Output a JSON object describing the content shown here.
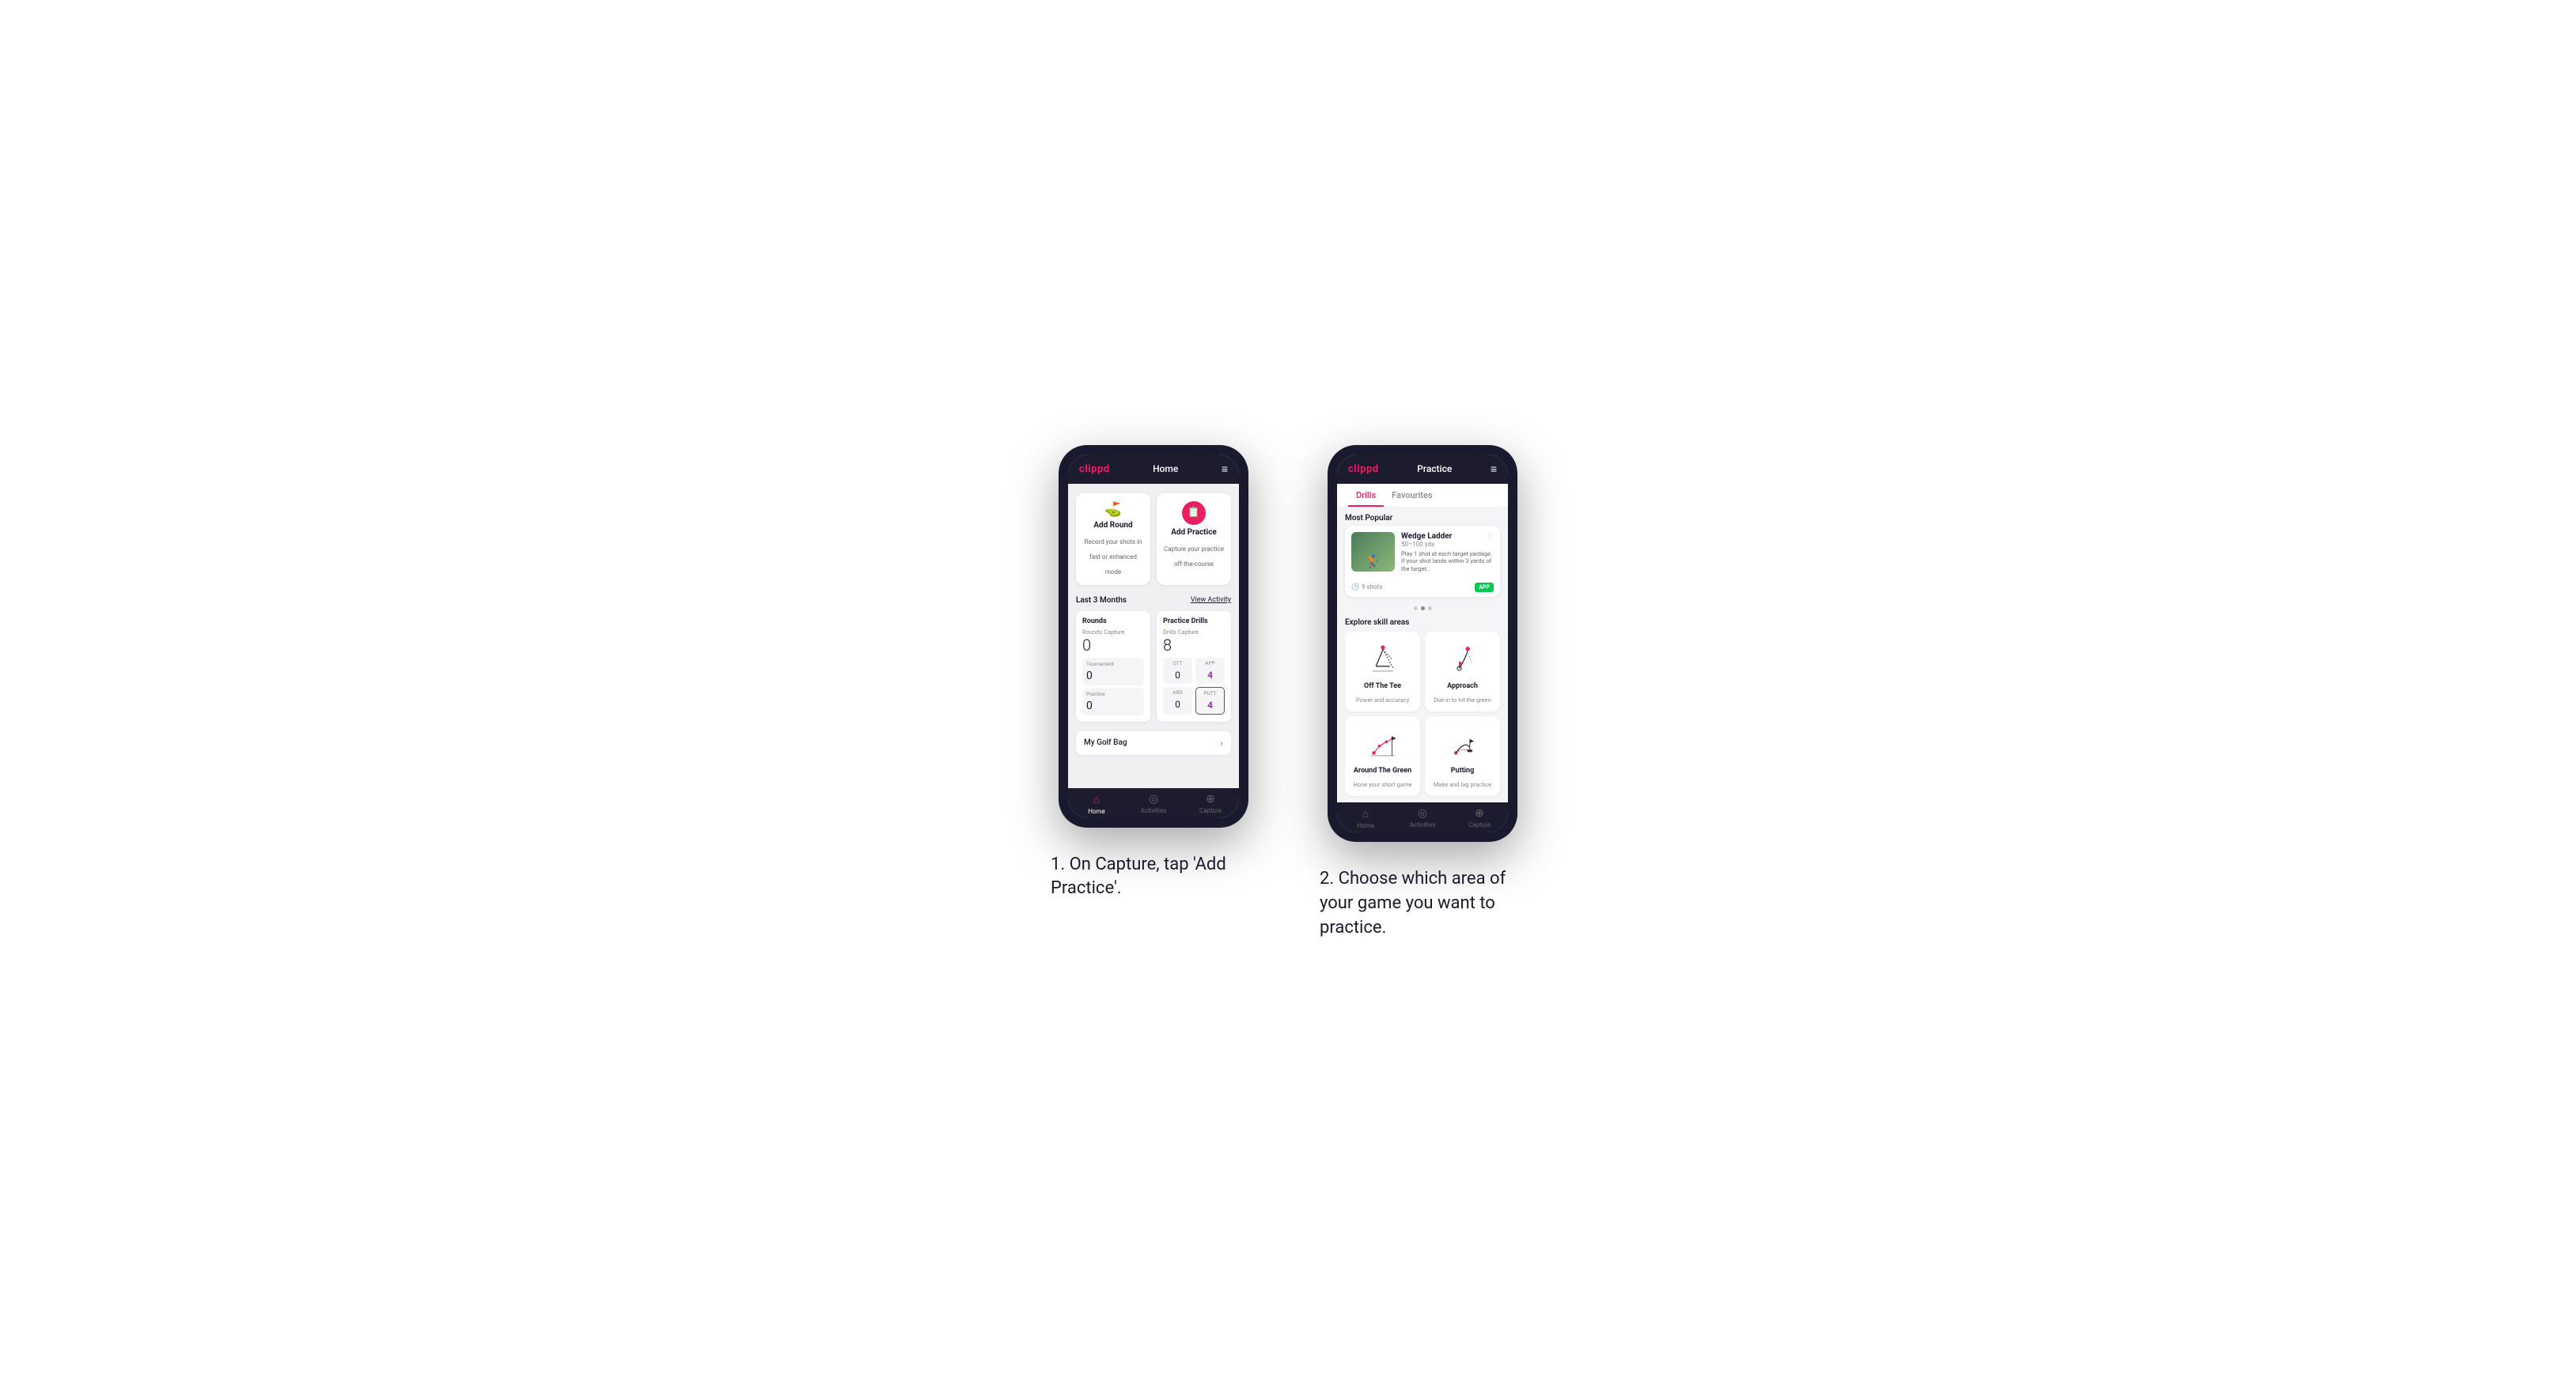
{
  "phone1": {
    "header": {
      "logo": "clippd",
      "title": "Home",
      "menu_icon": "≡"
    },
    "action_cards": [
      {
        "id": "add-round",
        "icon": "⛳",
        "title": "Add Round",
        "description": "Record your shots in fast or enhanced mode"
      },
      {
        "id": "add-practice",
        "icon": "📋",
        "title": "Add Practice",
        "description": "Capture your practice off-the-course"
      }
    ],
    "stats_header": {
      "title": "Last 3 Months",
      "link": "View Activity"
    },
    "rounds_card": {
      "title": "Rounds",
      "sub_label": "Rounds Capture",
      "big_number": "0",
      "rows": [
        {
          "label": "Tournament",
          "value": "0"
        },
        {
          "label": "Practice",
          "value": "0"
        }
      ]
    },
    "practice_card": {
      "title": "Practice Drills",
      "sub_label": "Drills Capture",
      "big_number": "8",
      "mini_stats": [
        {
          "label": "OTT",
          "value": "0"
        },
        {
          "label": "APP",
          "value": "4",
          "highlight": true
        },
        {
          "label": "ARG",
          "value": "0"
        },
        {
          "label": "PUTT",
          "value": "4",
          "highlight": true
        }
      ]
    },
    "golf_bag": {
      "label": "My Golf Bag"
    },
    "bottom_nav": [
      {
        "icon": "⌂",
        "label": "Home",
        "active": true
      },
      {
        "icon": "◎",
        "label": "Activities",
        "active": false
      },
      {
        "icon": "⊕",
        "label": "Capture",
        "active": false
      }
    ]
  },
  "phone2": {
    "header": {
      "logo": "clippd",
      "title": "Practice",
      "menu_icon": "≡"
    },
    "tabs": [
      {
        "label": "Drills",
        "active": true
      },
      {
        "label": "Favourites",
        "active": false
      }
    ],
    "most_popular": {
      "label": "Most Popular",
      "featured_card": {
        "title": "Wedge Ladder",
        "yardage": "50–100 yds",
        "description": "Play 1 shot at each target yardage. If your shot lands within 3 yards of the target..",
        "shots": "9 shots",
        "badge": "APP"
      },
      "carousel_dots": [
        {
          "active": false
        },
        {
          "active": true
        },
        {
          "active": false
        }
      ]
    },
    "explore": {
      "label": "Explore skill areas",
      "skills": [
        {
          "id": "off-the-tee",
          "name": "Off The Tee",
          "description": "Power and accuracy"
        },
        {
          "id": "approach",
          "name": "Approach",
          "description": "Dial-in to hit the green"
        },
        {
          "id": "around-the-green",
          "name": "Around The Green",
          "description": "Hone your short game"
        },
        {
          "id": "putting",
          "name": "Putting",
          "description": "Make and lag practice"
        }
      ]
    },
    "bottom_nav": [
      {
        "icon": "⌂",
        "label": "Home",
        "active": false
      },
      {
        "icon": "◎",
        "label": "Activities",
        "active": false
      },
      {
        "icon": "⊕",
        "label": "Capture",
        "active": false
      }
    ]
  },
  "captions": [
    "1. On Capture, tap 'Add Practice'.",
    "2. Choose which area of your game you want to practice."
  ],
  "colors": {
    "brand_pink": "#e91e63",
    "dark_navy": "#1c1c2e",
    "green_badge": "#00c851",
    "purple_highlight": "#9c27b0"
  }
}
